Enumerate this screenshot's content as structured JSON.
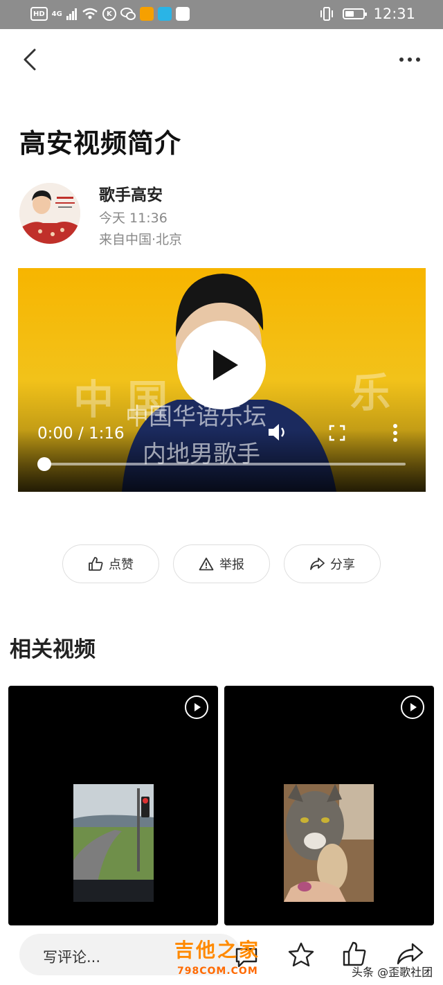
{
  "status_bar": {
    "network_hd": "HD",
    "network_4g": "4G",
    "time": "12:31"
  },
  "article": {
    "title": "高安视频简介",
    "author": "歌手高安",
    "time": "今天 11:36",
    "location": "来自中国·北京"
  },
  "video": {
    "time_display": "0:00 / 1:16",
    "progress": 0
  },
  "actions": {
    "like": "点赞",
    "report": "举报",
    "share": "分享"
  },
  "related": {
    "title": "相关视频"
  },
  "bottom_bar": {
    "comment_placeholder": "写评论...",
    "watermark_logo": "吉他之家",
    "watermark_url": "798COM.COM",
    "watermark_text": "头条 @歪歌社团"
  },
  "colors": {
    "status_bar": "#8d8d8d",
    "video_bg": "#f4b400",
    "watermark": "#ff8a00"
  }
}
